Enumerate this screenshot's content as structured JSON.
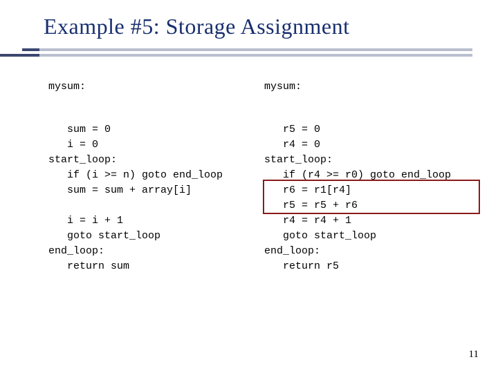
{
  "title": "Example #5: Storage Assignment",
  "left": {
    "label": "mysum:",
    "block1": "   sum = 0\n   i = 0\nstart_loop:\n   if (i >= n) goto end_loop\n   sum = sum + array[i]",
    "block2": "   i = i + 1\n   goto start_loop\nend_loop:\n   return sum"
  },
  "right": {
    "label": "mysum:",
    "block": "   r5 = 0\n   r4 = 0\nstart_loop:\n   if (r4 >= r0) goto end_loop\n   r6 = r1[r4]\n   r5 = r5 + r6\n   r4 = r4 + 1\n   goto start_loop\nend_loop:\n   return r5"
  },
  "page_number": "11"
}
